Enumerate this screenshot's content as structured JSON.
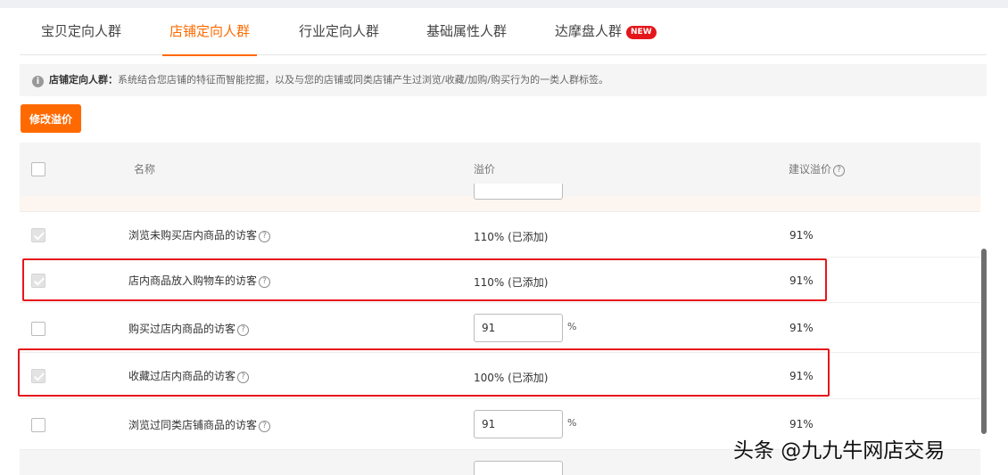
{
  "tabs": [
    {
      "label": "宝贝定向人群"
    },
    {
      "label": "店铺定向人群"
    },
    {
      "label": "行业定向人群"
    },
    {
      "label": "基础属性人群"
    },
    {
      "label": "达摩盘人群",
      "badge": "NEW"
    }
  ],
  "active_tab_index": 1,
  "notice": {
    "title": "店铺定向人群：",
    "text": "系统结合您店铺的特征而智能挖掘，以及与您的店铺或同类店铺产生过浏览/收藏/加购/购买行为的一类人群标签。"
  },
  "toolbar": {
    "modify_price_label": "修改溢价"
  },
  "table": {
    "headers": {
      "name": "名称",
      "price": "溢价",
      "suggested": "建议溢价"
    },
    "rows": [
      {
        "name": "浏览未购买店内商品的访客",
        "checked": true,
        "price_text": "110% (已添加)",
        "suggested": "91%"
      },
      {
        "name": "店内商品放入购物车的访客",
        "checked": true,
        "price_text": "110% (已添加)",
        "suggested": "91%"
      },
      {
        "name": "购买过店内商品的访客",
        "checked": false,
        "price_value": "91",
        "price_unit": "%",
        "suggested": "91%"
      },
      {
        "name": "收藏过店内商品的访客",
        "checked": true,
        "price_text": "100% (已添加)",
        "suggested": "91%"
      },
      {
        "name": "浏览过同类店铺商品的访客",
        "checked": false,
        "price_value": "91",
        "price_unit": "%",
        "suggested": "91%"
      }
    ]
  },
  "watermark": "头条 @九九牛网店交易",
  "colors": {
    "accent": "#ff6a00",
    "highlight": "#e5161b",
    "new_badge": "#e5161b"
  }
}
